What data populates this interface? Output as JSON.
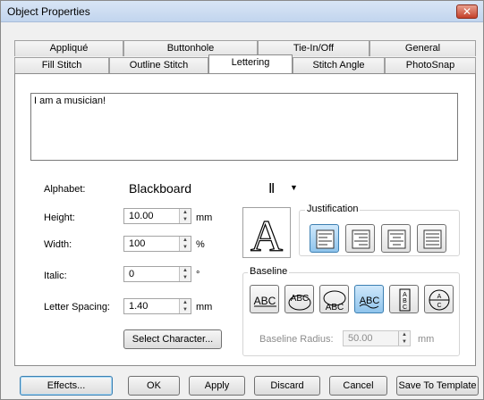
{
  "window": {
    "title": "Object Properties",
    "close_glyph": "✕"
  },
  "tabs_row1": [
    "Appliqué",
    "Buttonhole",
    "Tie-In/Off",
    "General"
  ],
  "tabs_row2": [
    "Fill Stitch",
    "Outline Stitch",
    "Lettering",
    "Stitch Angle",
    "PhotoSnap"
  ],
  "active_tab": "Lettering",
  "lettering": {
    "text": "I am a musician!",
    "alphabet_label": "Alphabet:",
    "alphabet_value": "Blackboard",
    "height_label": "Height:",
    "height_value": "10.00",
    "height_unit": "mm",
    "width_label": "Width:",
    "width_value": "100",
    "width_unit": "%",
    "italic_label": "Italic:",
    "italic_value": "0",
    "italic_unit": "°",
    "spacing_label": "Letter Spacing:",
    "spacing_value": "1.40",
    "spacing_unit": "mm",
    "select_character_label": "Select Character...",
    "preview_glyph": "A",
    "justification_label": "Justification",
    "baseline_label": "Baseline",
    "baseline_radius_label": "Baseline Radius:",
    "baseline_radius_value": "50.00",
    "baseline_radius_unit": "mm",
    "baseline_glyph": "ABC"
  },
  "footer": {
    "effects": "Effects...",
    "ok": "OK",
    "apply": "Apply",
    "discard": "Discard",
    "cancel": "Cancel",
    "save_template": "Save To Template"
  },
  "colors": {
    "accent": "#3c7fb1",
    "selected_fill": "#8fc4ec",
    "close": "#c4402a"
  }
}
